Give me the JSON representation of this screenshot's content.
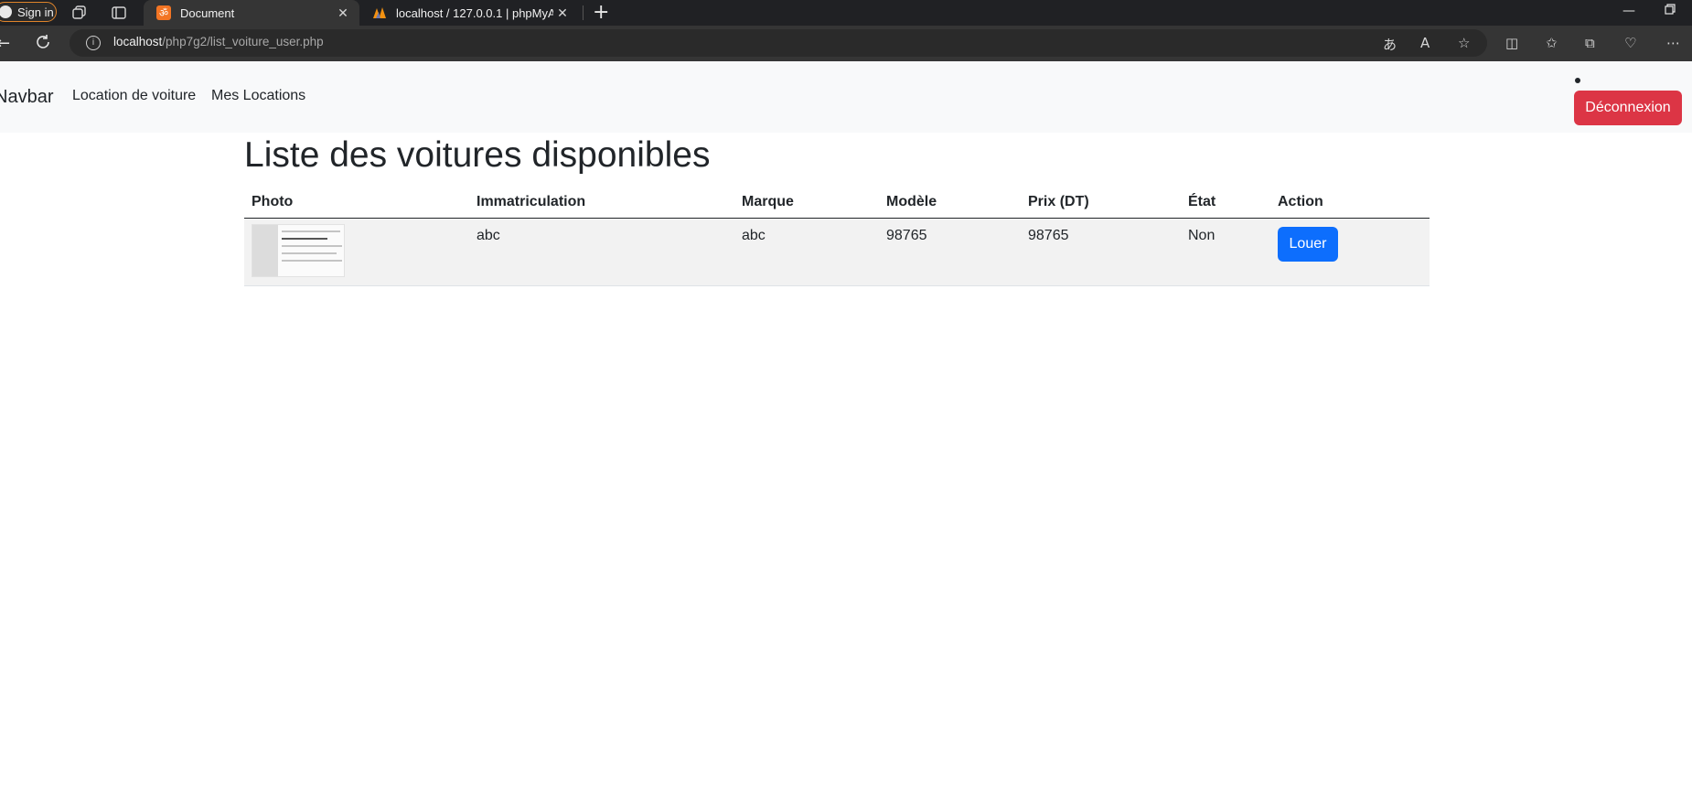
{
  "browser": {
    "signin_label": "Sign in",
    "tabs": [
      {
        "title": "Document",
        "close": "✕",
        "favicon": "xampp-icon"
      },
      {
        "title": "localhost / 127.0.0.1 | phpMyAdm",
        "close": "✕",
        "favicon": "phpmyadmin-icon"
      }
    ],
    "new_tab_label": "+",
    "url_host": "localhost",
    "url_path": "/php7g2/list_voiture_user.php"
  },
  "navbar": {
    "brand": "Navbar",
    "links": [
      "Location de voiture",
      "Mes Locations"
    ],
    "logout_label": "Déconnexion"
  },
  "main": {
    "title": "Liste des voitures disponibles",
    "table": {
      "headers": [
        "Photo",
        "Immatriculation",
        "Marque",
        "Modèle",
        "Prix (DT)",
        "État",
        "Action"
      ],
      "rows": [
        {
          "immatriculation": "abc",
          "marque": "abc",
          "modele": "98765",
          "prix": "98765",
          "etat": "Non",
          "action": "Louer"
        }
      ]
    }
  },
  "colors": {
    "danger": "#dc3545",
    "primary": "#0d6efd",
    "navbar_bg": "#f8f9fa"
  }
}
